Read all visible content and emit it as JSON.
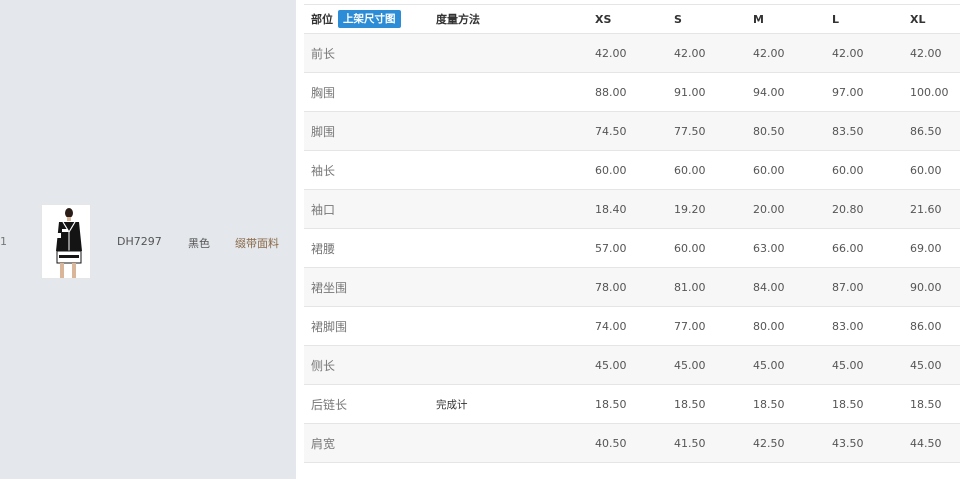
{
  "product": {
    "index": "1",
    "sku": "DH7297",
    "color": "黑色",
    "fabric": "缀带面料",
    "thumbnail_icon": "model-jacket-photo"
  },
  "size_table": {
    "headers": {
      "part": "部位",
      "upload_button": "上架尺寸图",
      "method": "度量方法",
      "sizes": [
        "XS",
        "S",
        "M",
        "L",
        "XL"
      ]
    },
    "rows": [
      {
        "part": "前长",
        "method": "",
        "values": [
          "42.00",
          "42.00",
          "42.00",
          "42.00",
          "42.00"
        ]
      },
      {
        "part": "胸围",
        "method": "",
        "values": [
          "88.00",
          "91.00",
          "94.00",
          "97.00",
          "100.00"
        ]
      },
      {
        "part": "脚围",
        "method": "",
        "values": [
          "74.50",
          "77.50",
          "80.50",
          "83.50",
          "86.50"
        ]
      },
      {
        "part": "袖长",
        "method": "",
        "values": [
          "60.00",
          "60.00",
          "60.00",
          "60.00",
          "60.00"
        ]
      },
      {
        "part": "袖口",
        "method": "",
        "values": [
          "18.40",
          "19.20",
          "20.00",
          "20.80",
          "21.60"
        ]
      },
      {
        "part": "裙腰",
        "method": "",
        "values": [
          "57.00",
          "60.00",
          "63.00",
          "66.00",
          "69.00"
        ]
      },
      {
        "part": "裙坐围",
        "method": "",
        "values": [
          "78.00",
          "81.00",
          "84.00",
          "87.00",
          "90.00"
        ]
      },
      {
        "part": "裙脚围",
        "method": "",
        "values": [
          "74.00",
          "77.00",
          "80.00",
          "83.00",
          "86.00"
        ]
      },
      {
        "part": "侧长",
        "method": "",
        "values": [
          "45.00",
          "45.00",
          "45.00",
          "45.00",
          "45.00"
        ]
      },
      {
        "part": "后链长",
        "method": "完成计",
        "values": [
          "18.50",
          "18.50",
          "18.50",
          "18.50",
          "18.50"
        ]
      },
      {
        "part": "肩宽",
        "method": "",
        "values": [
          "40.50",
          "41.50",
          "42.50",
          "43.50",
          "44.50"
        ]
      }
    ]
  }
}
